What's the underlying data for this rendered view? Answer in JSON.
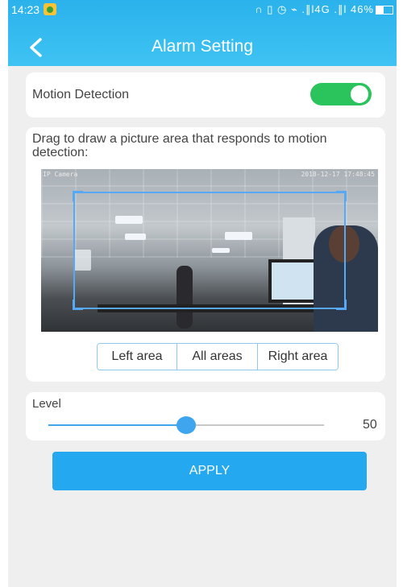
{
  "status_bar": {
    "time": "14:23",
    "icons": "∩ ▯ ◷ ⌁ .∥l4G .∥l",
    "battery": "46%"
  },
  "header": {
    "title": "Alarm Setting",
    "back_icon": "chevron-left-icon"
  },
  "motion_detection": {
    "label": "Motion Detection",
    "enabled": true,
    "toggle_color": "#2bc35b"
  },
  "area": {
    "description": "Drag to draw a picture area that responds to motion detection:",
    "camera_overlay_left": "IP Camera",
    "camera_overlay_right": "2018-12-17 17:48:45",
    "buttons": [
      "Left area",
      "All areas",
      "Right area"
    ]
  },
  "level": {
    "label": "Level",
    "value": 50,
    "value_text": "50",
    "fraction": 0.5
  },
  "apply": {
    "label": "APPLY"
  },
  "colors": {
    "header_accent": "#2bb2ec",
    "selection_box": "#58a9f5",
    "apply_button": "#24a8f0"
  }
}
